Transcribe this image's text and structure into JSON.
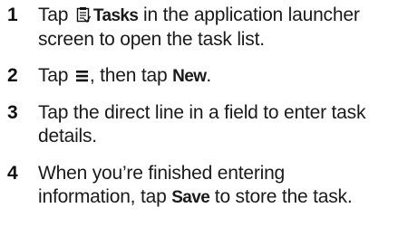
{
  "steps": [
    {
      "number": "1",
      "lines": [
        {
          "pre": "Tap",
          "icon": "tasks-icon",
          "keyword": "Tasks",
          "post": " in the application launcher"
        },
        {
          "text": "screen to open the task list."
        }
      ]
    },
    {
      "number": "2",
      "lines": [
        {
          "pre": "Tap",
          "icon": "menu-icon",
          "mid": ", then tap ",
          "keyword": "New",
          "post": "."
        }
      ]
    },
    {
      "number": "3",
      "lines": [
        {
          "text": "Tap the direct line in a field to enter task"
        },
        {
          "text": "details."
        }
      ]
    },
    {
      "number": "4",
      "lines": [
        {
          "text": "When you’re finished entering"
        },
        {
          "pre": "information, tap ",
          "keyword": "Save",
          "post": " to store the task."
        }
      ]
    }
  ]
}
